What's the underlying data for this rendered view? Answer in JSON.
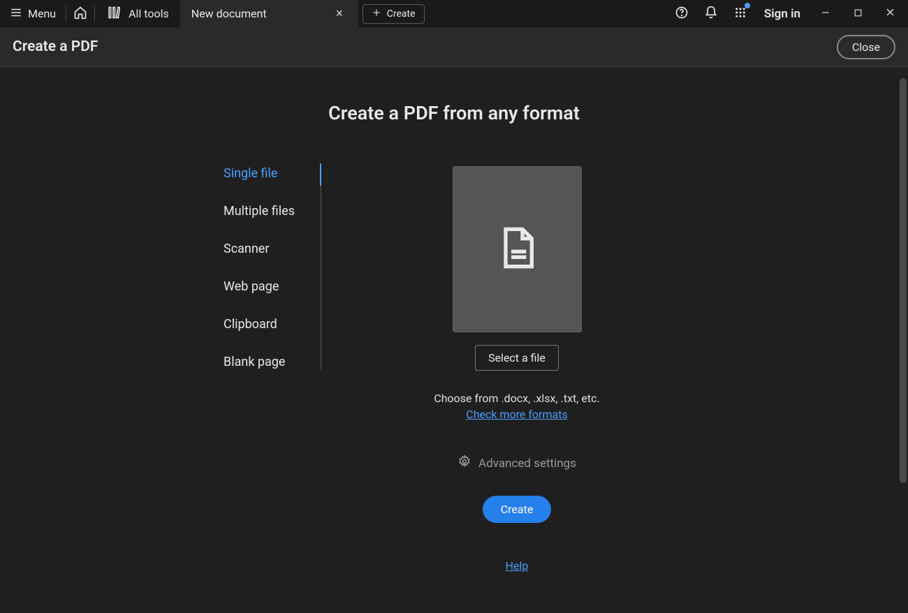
{
  "topbar": {
    "menu_label": "Menu",
    "all_tools_label": "All tools",
    "tab_title": "New document",
    "create_label": "Create",
    "signin_label": "Sign in"
  },
  "header": {
    "title": "Create a PDF",
    "close_label": "Close"
  },
  "main": {
    "heading": "Create a PDF from any format",
    "side_items": [
      {
        "label": "Single file",
        "active": true
      },
      {
        "label": "Multiple files",
        "active": false
      },
      {
        "label": "Scanner",
        "active": false
      },
      {
        "label": "Web page",
        "active": false
      },
      {
        "label": "Clipboard",
        "active": false
      },
      {
        "label": "Blank page",
        "active": false
      }
    ],
    "select_file_label": "Select a file",
    "hint_text": "Choose from .docx, .xlsx, .txt, etc.",
    "check_formats_label": "Check more formats",
    "advanced_label": "Advanced settings",
    "create_btn_label": "Create",
    "help_label": "Help"
  }
}
